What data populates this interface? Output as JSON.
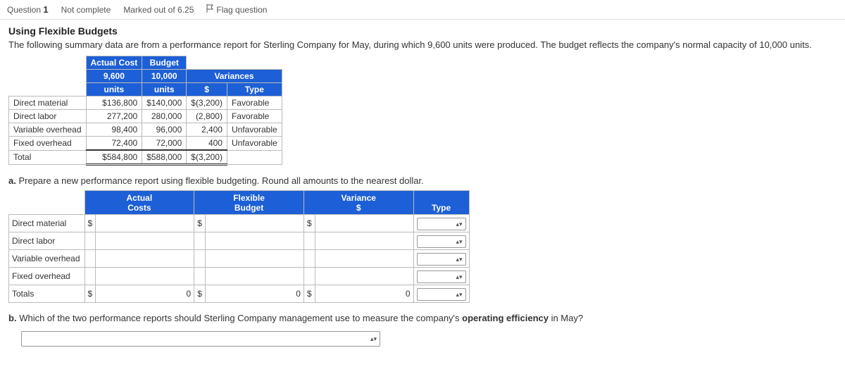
{
  "header": {
    "question_label": "Question",
    "question_number": "1",
    "status": "Not complete",
    "marked": "Marked out of 6.25",
    "flag": "Flag question"
  },
  "title": "Using Flexible Budgets",
  "intro": "The following summary data are from a performance report for Sterling Company for May, during which 9,600 units were produced. The budget reflects the company's normal capacity of 10,000 units.",
  "table1": {
    "headers": {
      "actual_top": "Actual Cost",
      "budget_top": "Budget",
      "actual_mid": "9,600",
      "budget_mid": "10,000",
      "variances": "Variances",
      "actual_bot": "units",
      "budget_bot": "units",
      "var_amt": "$",
      "var_type": "Type"
    },
    "rows": [
      {
        "label": "Direct material",
        "actual": "$136,800",
        "budget": "$140,000",
        "var": "$(3,200)",
        "type": "Favorable"
      },
      {
        "label": "Direct labor",
        "actual": "277,200",
        "budget": "280,000",
        "var": "(2,800)",
        "type": "Favorable"
      },
      {
        "label": "Variable overhead",
        "actual": "98,400",
        "budget": "96,000",
        "var": "2,400",
        "type": "Unfavorable"
      },
      {
        "label": "Fixed overhead",
        "actual": "72,400",
        "budget": "72,000",
        "var": "400",
        "type": "Unfavorable"
      }
    ],
    "total": {
      "label": "Total",
      "actual": "$584,800",
      "budget": "$588,000",
      "var": "$(3,200)",
      "type": ""
    }
  },
  "part_a": {
    "label": "a.",
    "text": "Prepare a new performance report using flexible budgeting. Round all amounts to the nearest dollar.",
    "headers": {
      "actual": "Actual",
      "costs": "Costs",
      "flexible": "Flexible",
      "budget": "Budget",
      "variance": "Variance",
      "var_amt": "$",
      "type": "Type"
    },
    "rows": [
      {
        "label": "Direct material",
        "d1": "$",
        "d2": "$",
        "d3": "$"
      },
      {
        "label": "Direct labor",
        "d1": "",
        "d2": "",
        "d3": ""
      },
      {
        "label": "Variable overhead",
        "d1": "",
        "d2": "",
        "d3": ""
      },
      {
        "label": "Fixed overhead",
        "d1": "",
        "d2": "",
        "d3": ""
      }
    ],
    "totals": {
      "label": "Totals",
      "d1": "$",
      "v1": "0",
      "d2": "$",
      "v2": "0",
      "d3": "$",
      "v3": "0"
    }
  },
  "part_b": {
    "label": "b.",
    "text_before": "Which of the two performance reports should Sterling Company management use to measure the company's ",
    "text_bold": "operating efficiency",
    "text_after": " in May?"
  }
}
